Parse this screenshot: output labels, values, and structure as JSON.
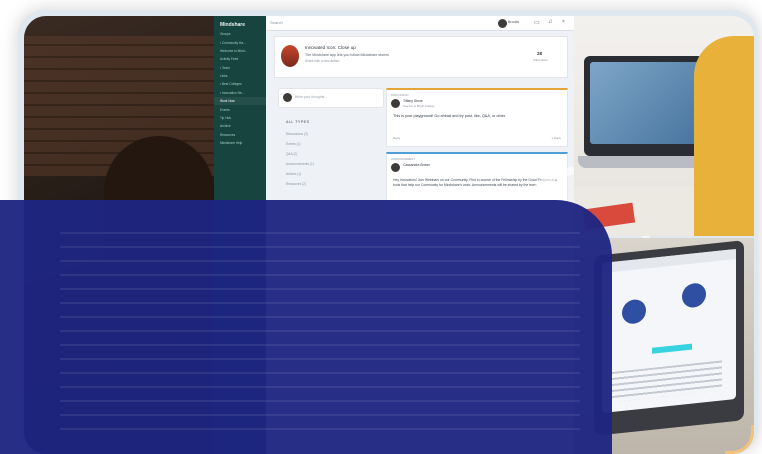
{
  "app": {
    "sidebar": {
      "title": "Mindshare",
      "items": [
        "Groups",
        "• Community Ha...",
        "  Welcome to Mind...",
        "  Activity Feed",
        "• Team",
        "  Links",
        "• Best Colleges",
        "• Innovation Ne...",
        "  Work Now",
        "  Events",
        "  Tip Hub",
        "  Archive",
        "Resources",
        "  Mindshare Help"
      ],
      "active_index": 8
    },
    "topbar": {
      "search_placeholder": "Search",
      "user_name": "Brooks"
    },
    "header_card": {
      "title": "Innovated Icon: Close up",
      "subtitle": "The Mindshare app lets you follow Mindshare stories",
      "meta": "Share with a new author",
      "count": "28",
      "count_label": "Subscribers"
    },
    "post_box": {
      "placeholder": "Write your thoughts..."
    },
    "filters": {
      "label": "ALL TYPES",
      "items": [
        "Discussions (3)",
        "Events (1)",
        "Q&A (2)",
        "Announcements (1)",
        "Articles (1)",
        "Resources (2)"
      ]
    },
    "posts": [
      {
        "label": "DISCUSSION",
        "author": "Tiffany Stone",
        "role": "Teacher at Bright College",
        "text": "This is your playground! Go ahead and try post, like, Q&A, or other.",
        "footer_left": "Reply",
        "footer_right": "1 Reply"
      },
      {
        "label": "ANNOUNCEMENT",
        "author": "Cassandra Brown",
        "role": "",
        "text": "Hey Innovators! Join Webinars on our Community. Find in-course of the Fellowship by the Good Program and tools that help our Community for Mindshare's work. Announcements will be shared by the team.",
        "footer_left": "",
        "footer_right": ""
      }
    ]
  },
  "colors": {
    "sidebar": "#17443f",
    "overlay": "#1e2581",
    "accent_orange": "#e3a43a",
    "accent_blue": "#4f9fd6"
  }
}
